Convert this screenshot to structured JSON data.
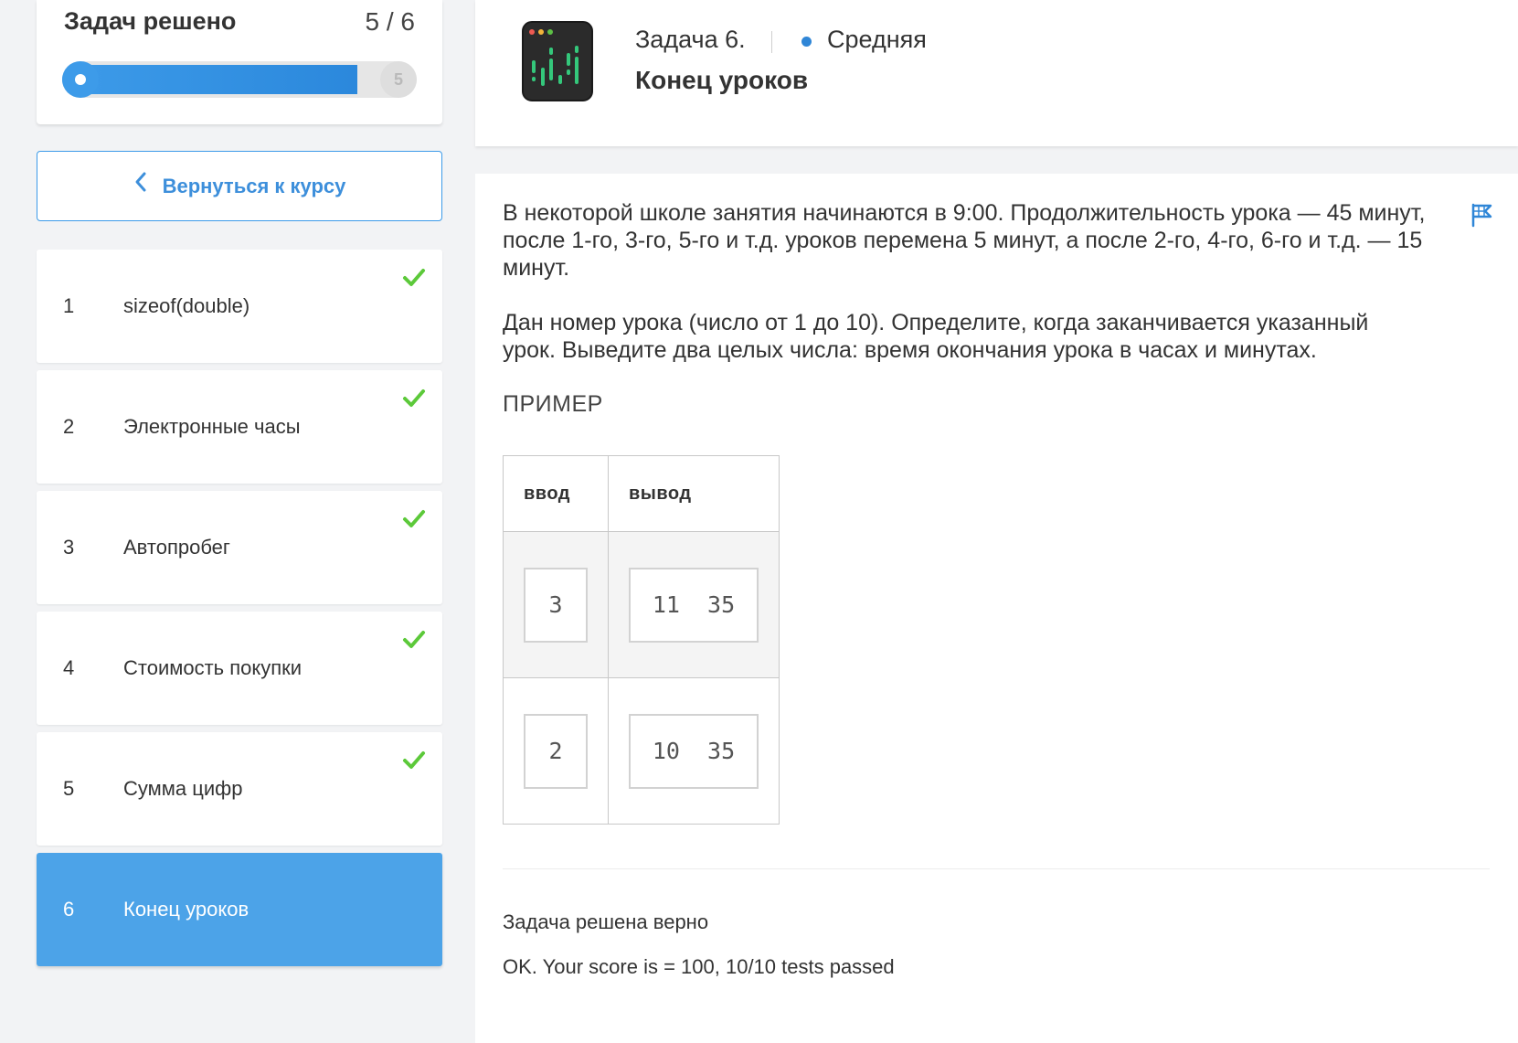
{
  "progress": {
    "title": "Задач решено",
    "count": "5 / 6",
    "solved": 5,
    "total": 6,
    "end_label": "5"
  },
  "back_button": {
    "label": "Вернуться к курсу"
  },
  "tasks": [
    {
      "number": "1",
      "name": "sizeof(double)",
      "solved": true
    },
    {
      "number": "2",
      "name": "Электронные часы",
      "solved": true
    },
    {
      "number": "3",
      "name": "Автопробег",
      "solved": true
    },
    {
      "number": "4",
      "name": "Стоимость покупки",
      "solved": true
    },
    {
      "number": "5",
      "name": "Сумма цифр",
      "solved": true
    },
    {
      "number": "6",
      "name": "Конец уроков",
      "solved": false,
      "active": true
    }
  ],
  "header": {
    "task_label": "Задача 6.",
    "level": "Средняя",
    "title": "Конец уроков"
  },
  "statement": {
    "paragraph1": "В некоторой школе занятия начинаются в 9:00. Продолжительность урока — 45 минут, после 1-го, 3-го, 5-го и т.д. уроков перемена 5 минут, а после 2-го, 4-го, 6-го и т.д. — 15 минут.",
    "paragraph2": "Дан номер урока (число от 1 до 10). Определите, когда заканчивается указанный урок. Выведите два целых числа: время окончания урока в часах и минутах."
  },
  "example": {
    "title": "ПРИМЕР",
    "headers": {
      "input": "ввод",
      "output": "вывод"
    },
    "rows": [
      {
        "input": "3",
        "output": "11  35"
      },
      {
        "input": "2",
        "output": "10  35"
      }
    ]
  },
  "result": {
    "status": "Задача решена верно",
    "detail": "OK. Your score is = 100, 10/10 tests passed"
  },
  "colors": {
    "accent": "#4ca3e8",
    "check": "#5cc93a",
    "level_dot": "#2f86d7"
  }
}
